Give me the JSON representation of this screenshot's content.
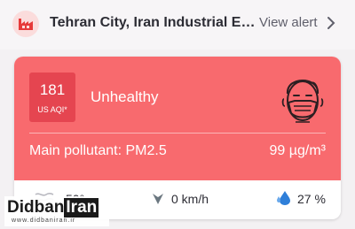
{
  "alert": {
    "icon": "factory-icon",
    "title": "Tehran City, Iran Industrial Emissions",
    "view_label": "View alert"
  },
  "aqi": {
    "value": "181",
    "unit": "US AQI*",
    "level": "Unhealthy",
    "level_icon": "face-mask-icon",
    "card_color": "#f86a6e",
    "badge_color": "#e54550",
    "pollutant_label": "Main pollutant: PM2.5",
    "pollutant_value": "99 µg/m³"
  },
  "weather": {
    "temperature": "50°",
    "wind": "0 km/h",
    "humidity": "27 %"
  },
  "watermark": {
    "name": "Didban",
    "name_highlight": "Iran",
    "url": "www.didbaniran.ir"
  }
}
